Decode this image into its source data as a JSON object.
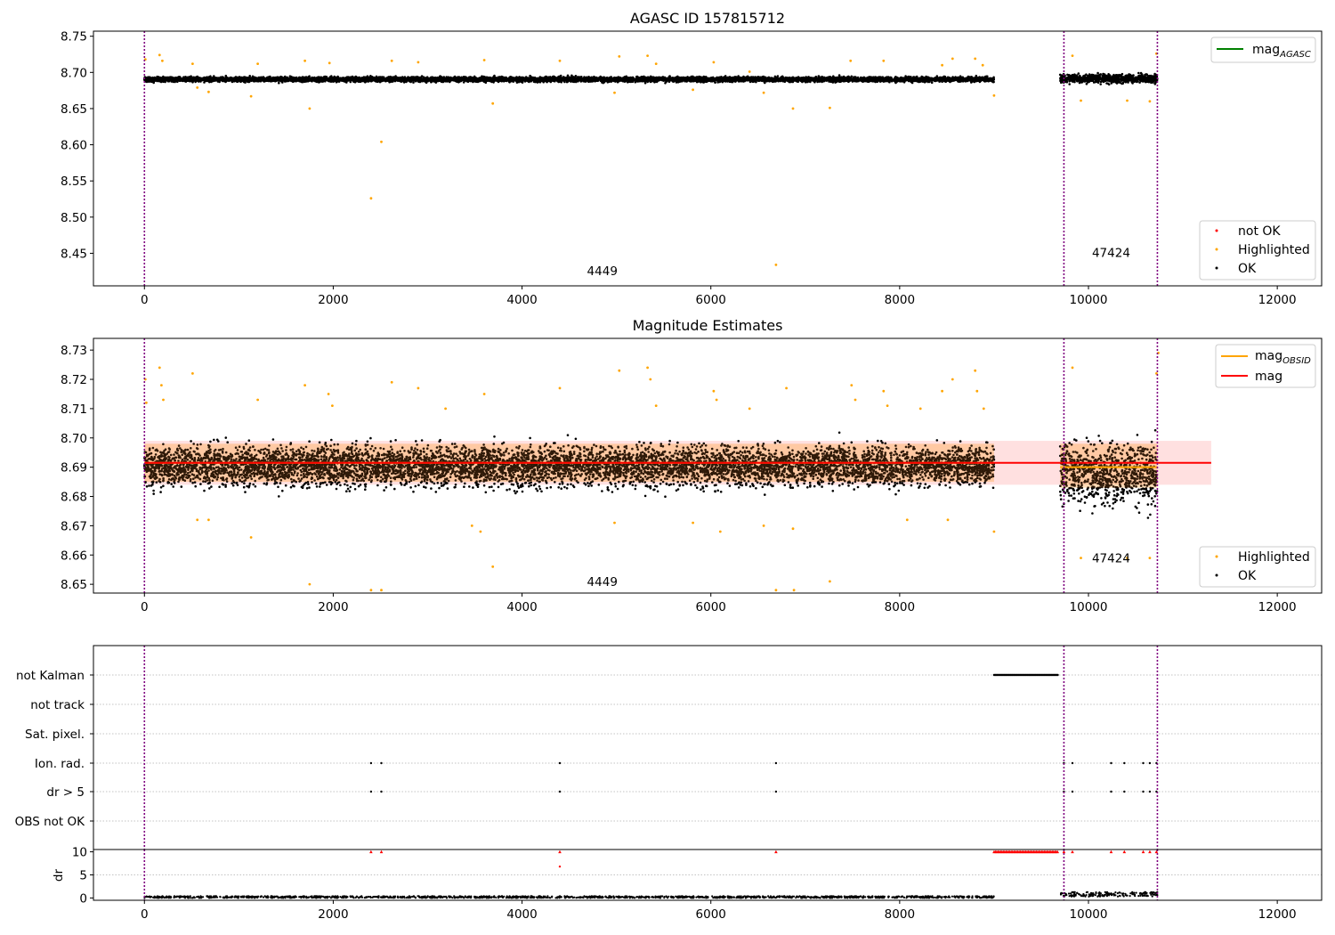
{
  "chart_data": [
    {
      "id": "agasc",
      "type": "scatter",
      "title": "AGASC ID 157815712",
      "xlim": [
        -540,
        12470
      ],
      "ylim": [
        8.405,
        8.757
      ],
      "xticks": [
        0,
        2000,
        4000,
        6000,
        8000,
        10000,
        12000
      ],
      "xtick_labels": [
        "0",
        "2000",
        "4000",
        "6000",
        "8000",
        "10000",
        "12000"
      ],
      "yticks": [
        8.45,
        8.5,
        8.55,
        8.6,
        8.65,
        8.7,
        8.75
      ],
      "ytick_labels": [
        "8.45",
        "8.50",
        "8.55",
        "8.60",
        "8.65",
        "8.70",
        "8.75"
      ],
      "vlines": [
        0,
        9740,
        10730
      ],
      "obsid_labels": [
        {
          "text": "4449",
          "x": 4850,
          "y": 8.42
        },
        {
          "text": "47424",
          "x": 10240,
          "y": 8.445
        }
      ],
      "series": [
        {
          "name": "mag",
          "sub": "AGASC",
          "kind": "line",
          "color": "#008000"
        },
        {
          "name": "not OK",
          "kind": "points",
          "color": "#ff0000",
          "points": []
        },
        {
          "name": "Highlighted",
          "kind": "points",
          "color": "#ffa500",
          "points": [
            [
              10,
              8.718
            ],
            [
              160,
              8.724
            ],
            [
              190,
              8.716
            ],
            [
              510,
              8.712
            ],
            [
              560,
              8.679
            ],
            [
              680,
              8.673
            ],
            [
              1130,
              8.667
            ],
            [
              1200,
              8.712
            ],
            [
              1700,
              8.716
            ],
            [
              1750,
              8.65
            ],
            [
              1960,
              8.713
            ],
            [
              2400,
              8.526
            ],
            [
              2510,
              8.604
            ],
            [
              2620,
              8.716
            ],
            [
              2900,
              8.714
            ],
            [
              3600,
              8.717
            ],
            [
              3690,
              8.657
            ],
            [
              4400,
              8.716
            ],
            [
              4980,
              8.672
            ],
            [
              5030,
              8.722
            ],
            [
              5330,
              8.723
            ],
            [
              5420,
              8.712
            ],
            [
              5810,
              8.676
            ],
            [
              6030,
              8.714
            ],
            [
              6410,
              8.701
            ],
            [
              6560,
              8.672
            ],
            [
              6690,
              8.434
            ],
            [
              6870,
              8.65
            ],
            [
              7260,
              8.651
            ],
            [
              7480,
              8.716
            ],
            [
              7830,
              8.716
            ],
            [
              8450,
              8.71
            ],
            [
              8560,
              8.719
            ],
            [
              8800,
              8.719
            ],
            [
              8880,
              8.71
            ],
            [
              9000,
              8.668
            ],
            [
              9830,
              8.723
            ],
            [
              9920,
              8.661
            ],
            [
              10410,
              8.661
            ],
            [
              10650,
              8.66
            ],
            [
              10720,
              8.726
            ]
          ]
        },
        {
          "name": "OK",
          "kind": "points",
          "color": "#000000",
          "points": []
        }
      ],
      "legend_top": [
        "mag"
      ],
      "legend_bottom": [
        "not OK",
        "Highlighted",
        "OK"
      ]
    },
    {
      "id": "mag_estimates",
      "type": "scatter",
      "title": "Magnitude Estimates",
      "xlim": [
        -540,
        12470
      ],
      "ylim": [
        8.647,
        8.734
      ],
      "xticks": [
        0,
        2000,
        4000,
        6000,
        8000,
        10000,
        12000
      ],
      "xtick_labels": [
        "0",
        "2000",
        "4000",
        "6000",
        "8000",
        "10000",
        "12000"
      ],
      "yticks": [
        8.65,
        8.66,
        8.67,
        8.68,
        8.69,
        8.7,
        8.71,
        8.72,
        8.73
      ],
      "ytick_labels": [
        "8.65",
        "8.66",
        "8.67",
        "8.68",
        "8.69",
        "8.70",
        "8.71",
        "8.72",
        "8.73"
      ],
      "vlines": [
        0,
        9740,
        10730
      ],
      "obsid_labels": [
        {
          "text": "4449",
          "x": 4850,
          "y": 8.6495
        },
        {
          "text": "47424",
          "x": 10240,
          "y": 8.6575
        }
      ],
      "mag_line": {
        "value": 8.6915,
        "band": [
          8.684,
          8.699
        ],
        "x_range": [
          0,
          11300
        ]
      },
      "mag_obsid_segments": [
        {
          "x": [
            0,
            9000
          ],
          "value": 8.6915,
          "band": [
            8.685,
            8.698
          ]
        },
        {
          "x": [
            9700,
            10730
          ],
          "value": 8.69,
          "band": [
            8.683,
            8.698
          ]
        }
      ],
      "series": [
        {
          "name": "mag",
          "sub": "OBSID",
          "kind": "line",
          "color": "#ffa500"
        },
        {
          "name": "mag",
          "kind": "line",
          "color": "#ff0000"
        },
        {
          "name": "Highlighted",
          "kind": "points",
          "color": "#ffa500",
          "points": [
            [
              10,
              8.72
            ],
            [
              20,
              8.712
            ],
            [
              160,
              8.724
            ],
            [
              180,
              8.718
            ],
            [
              200,
              8.713
            ],
            [
              510,
              8.722
            ],
            [
              560,
              8.672
            ],
            [
              680,
              8.672
            ],
            [
              1130,
              8.666
            ],
            [
              1200,
              8.713
            ],
            [
              1700,
              8.718
            ],
            [
              1750,
              8.65
            ],
            [
              1950,
              8.715
            ],
            [
              1990,
              8.711
            ],
            [
              2400,
              8.648
            ],
            [
              2510,
              8.648
            ],
            [
              2620,
              8.719
            ],
            [
              2900,
              8.717
            ],
            [
              3190,
              8.71
            ],
            [
              3470,
              8.67
            ],
            [
              3560,
              8.668
            ],
            [
              3600,
              8.715
            ],
            [
              3690,
              8.656
            ],
            [
              4400,
              8.717
            ],
            [
              4980,
              8.671
            ],
            [
              5030,
              8.723
            ],
            [
              5330,
              8.724
            ],
            [
              5360,
              8.72
            ],
            [
              5420,
              8.711
            ],
            [
              5810,
              8.671
            ],
            [
              6030,
              8.716
            ],
            [
              6060,
              8.713
            ],
            [
              6100,
              8.668
            ],
            [
              6410,
              8.71
            ],
            [
              6560,
              8.67
            ],
            [
              6690,
              8.648
            ],
            [
              6800,
              8.717
            ],
            [
              6870,
              8.669
            ],
            [
              6880,
              8.648
            ],
            [
              7260,
              8.651
            ],
            [
              7490,
              8.718
            ],
            [
              7530,
              8.713
            ],
            [
              7830,
              8.716
            ],
            [
              7870,
              8.711
            ],
            [
              8080,
              8.672
            ],
            [
              8220,
              8.71
            ],
            [
              8450,
              8.716
            ],
            [
              8510,
              8.672
            ],
            [
              8560,
              8.72
            ],
            [
              8800,
              8.723
            ],
            [
              8820,
              8.716
            ],
            [
              8890,
              8.71
            ],
            [
              9000,
              8.668
            ],
            [
              9830,
              8.724
            ],
            [
              9920,
              8.659
            ],
            [
              10410,
              8.659
            ],
            [
              10650,
              8.659
            ],
            [
              10720,
              8.722
            ],
            [
              10740,
              8.729
            ]
          ]
        },
        {
          "name": "OK",
          "kind": "points",
          "color": "#000000",
          "points": []
        }
      ],
      "legend_top": [
        "mag_obsid",
        "mag"
      ],
      "legend_bottom": [
        "Highlighted",
        "OK"
      ]
    },
    {
      "id": "flags",
      "type": "scatter",
      "xlim": [
        -540,
        12470
      ],
      "categories": [
        "not Kalman",
        "not track",
        "Sat. pixel.",
        "Ion. rad.",
        "dr > 5",
        "OBS not OK"
      ],
      "flag_points": {
        "not Kalman": {
          "ranges": [
            [
              9000,
              9680
            ]
          ],
          "points": []
        },
        "not track": {
          "ranges": [],
          "points": []
        },
        "Sat. pixel.": {
          "ranges": [],
          "points": []
        },
        "Ion. rad.": {
          "ranges": [],
          "points": [
            2400,
            2510,
            4400,
            6690,
            9740,
            9830,
            10240,
            10380,
            10580,
            10650,
            10720
          ]
        },
        "dr > 5": {
          "ranges": [],
          "points": [
            2400,
            2510,
            4400,
            6690,
            9740,
            9830,
            10240,
            10380,
            10580,
            10650,
            10720
          ]
        },
        "OBS not OK": {
          "ranges": [],
          "points": []
        }
      },
      "vlines": [
        0,
        9740,
        10730
      ]
    },
    {
      "id": "dr",
      "type": "scatter",
      "ylabel": "dr",
      "xlim": [
        -540,
        12470
      ],
      "ylim": [
        -0.5,
        10.5
      ],
      "xticks": [
        0,
        2000,
        4000,
        6000,
        8000,
        10000,
        12000
      ],
      "xtick_labels": [
        "0",
        "2000",
        "4000",
        "6000",
        "8000",
        "10000",
        "12000"
      ],
      "yticks": [
        0,
        5,
        10
      ],
      "ytick_labels": [
        "0",
        "5",
        "10"
      ],
      "vlines": [
        0,
        9740,
        10730
      ],
      "red_points": [
        2400,
        2510,
        4400,
        6690,
        9740,
        9830,
        10240,
        10380,
        10580,
        10650,
        10720
      ],
      "red_range": [
        9000,
        9680
      ],
      "extra_red": [
        [
          4400,
          6.8
        ]
      ],
      "segments": [
        {
          "x": [
            0,
            9000
          ],
          "mean": 0.2,
          "spread": 0.2
        },
        {
          "x": [
            9700,
            10730
          ],
          "mean": 0.8,
          "spread": 0.5
        }
      ]
    }
  ]
}
